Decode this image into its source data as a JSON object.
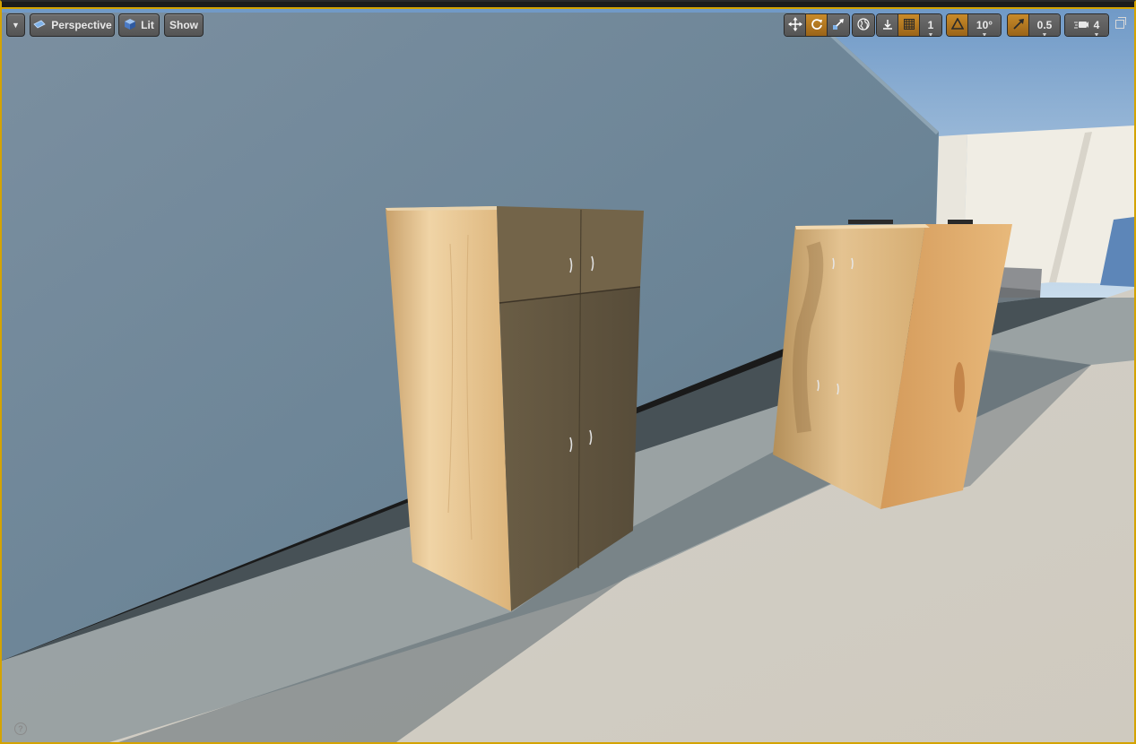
{
  "toolbar": {
    "view_mode": "Perspective",
    "lighting_mode": "Lit",
    "show_label": "Show",
    "grid_snap_value": "1",
    "rotation_snap_value": "10°",
    "scale_snap_value": "0.5",
    "camera_speed_value": "4",
    "help_label": "?"
  },
  "icons": {
    "menu": "chevron-down-icon",
    "perspective": "perspective-camera-icon",
    "lit": "lit-cube-icon",
    "translate": "move-arrows-icon",
    "rotate": "rotate-icon",
    "scale": "scale-icon",
    "world": "world-globe-icon",
    "surface_snap": "surface-snap-icon",
    "grid_snap": "grid-icon",
    "rotation_snap": "triangle-angle-icon",
    "scale_snap": "scale-arrow-icon",
    "camera_speed": "camera-speed-icon",
    "maximize": "maximize-icon",
    "help": "help-icon"
  },
  "colors": {
    "accent": "#d4a300",
    "active_button": "#b97a1f"
  }
}
